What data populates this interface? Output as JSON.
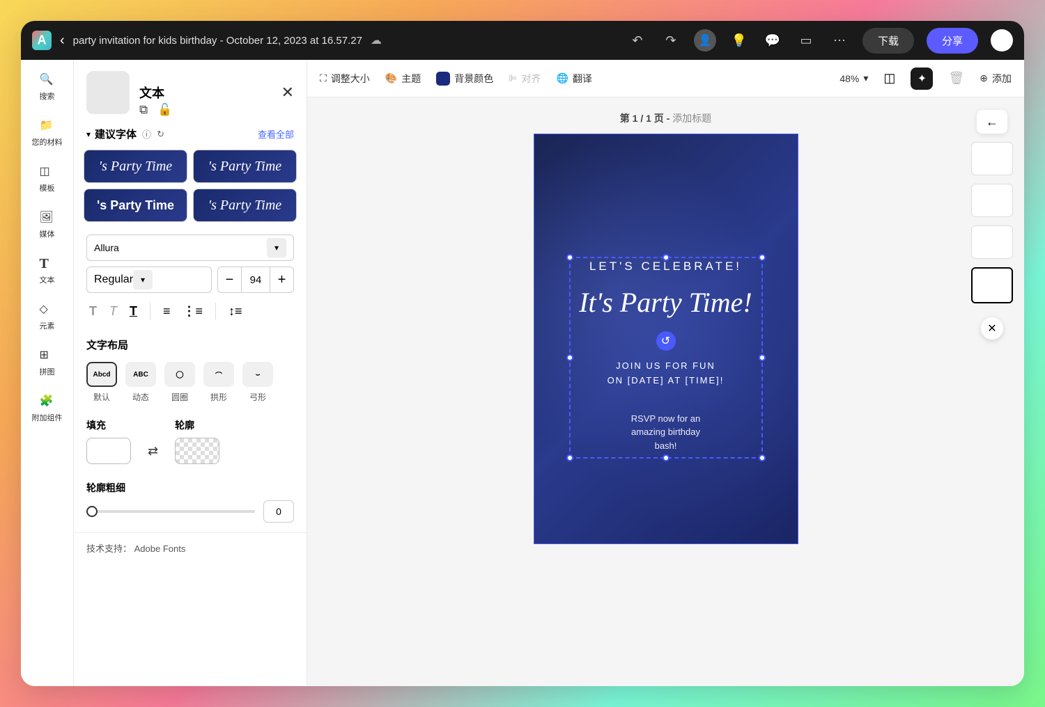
{
  "header": {
    "doc_title": "party invitation for kids birthday - October 12, 2023 at 16.57.27",
    "download": "下载",
    "share": "分享"
  },
  "rail": {
    "search": "搜索",
    "materials": "您的材料",
    "templates": "模板",
    "media": "媒体",
    "text": "文本",
    "elements": "元素",
    "grid": "拼图",
    "addons": "附加组件"
  },
  "panel": {
    "title": "文本",
    "suggested_fonts": "建议字体",
    "view_all": "查看全部",
    "sample_text": "'s Party Time",
    "font_name": "Allura",
    "font_style": "Regular",
    "font_size": "94",
    "layout_title": "文字布局",
    "layouts": {
      "default": "默认",
      "dynamic": "动态",
      "circle": "圆圈",
      "arch": "拱形",
      "bow": "弓形"
    },
    "fill": "填充",
    "outline": "轮廓",
    "outline_thickness": "轮廓粗细",
    "thickness_value": "0",
    "footer": "技术支持：",
    "footer_brand": "Adobe Fonts"
  },
  "toolbar": {
    "resize": "调整大小",
    "theme": "主题",
    "bg_color": "背景颜色",
    "align": "对齐",
    "translate": "翻译",
    "zoom": "48%",
    "add": "添加"
  },
  "canvas": {
    "page_label": "第 1 / 1 页 - ",
    "add_title": "添加标题",
    "celebrate": "LET'S CELEBRATE!",
    "party_time": "It's Party Time!",
    "join_line1": "JOIN US FOR FUN",
    "join_line2": "ON [DATE] AT [TIME]!",
    "rsvp_line1": "RSVP now for an",
    "rsvp_line2": "amazing birthday",
    "rsvp_line3": "bash!"
  }
}
